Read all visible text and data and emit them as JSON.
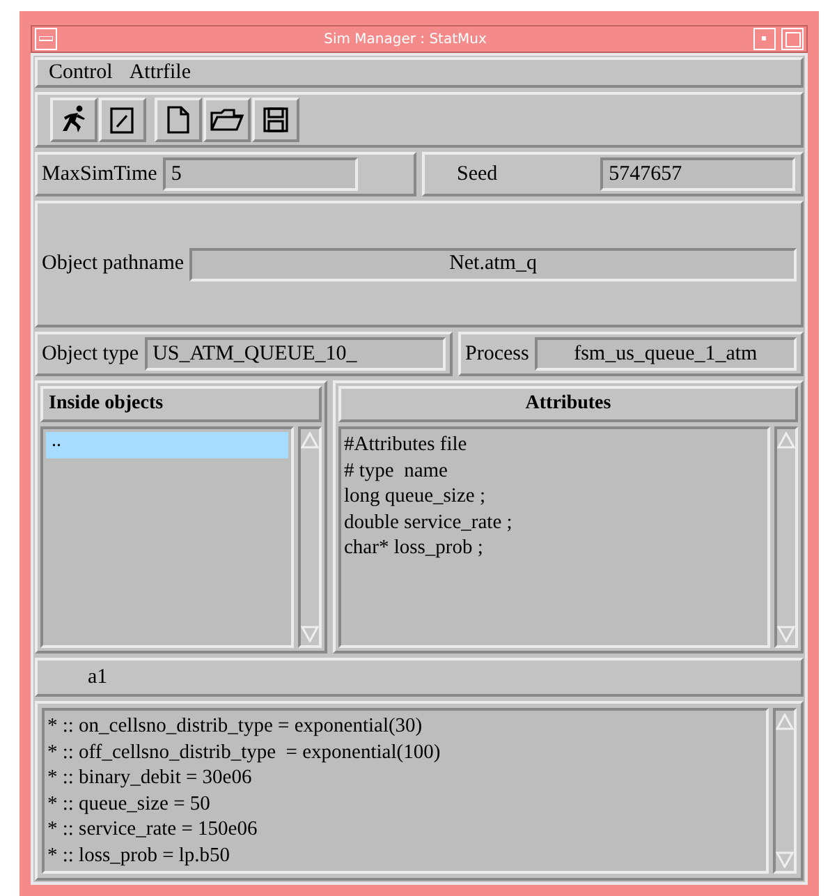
{
  "window": {
    "title": "Sim Manager : StatMux"
  },
  "menu": [
    "Control",
    "Attrfile"
  ],
  "toolbar": [
    {
      "kind": "run"
    },
    {
      "kind": "edit"
    },
    {
      "kind": "new"
    },
    {
      "kind": "open"
    },
    {
      "kind": "save"
    }
  ],
  "max_sim_time": {
    "label": "MaxSimTime",
    "value": "5"
  },
  "seed": {
    "label": "Seed",
    "value": "5747657"
  },
  "object_pathname": {
    "label": "Object pathname",
    "value": "Net.atm_q"
  },
  "object_type": {
    "label": "Object type",
    "value": "US_ATM_QUEUE_10_"
  },
  "process": {
    "label": "Process",
    "value": "fsm_us_queue_1_atm"
  },
  "inside_objects": {
    "title": "Inside objects",
    "items": [
      {
        "label": "..",
        "selected": true
      }
    ]
  },
  "attributes": {
    "title": "Attributes",
    "lines": [
      "#Attributes file",
      "# type  name",
      "long queue_size ;",
      "double service_rate ;",
      "char* loss_prob ;"
    ]
  },
  "object_name": "a1",
  "values": [
    "* :: on_cellsno_distrib_type = exponential(30)",
    "* :: off_cellsno_distrib_type  = exponential(100)",
    "* :: binary_debit = 30e06",
    "* :: queue_size = 50",
    "* :: service_rate = 150e06",
    "* :: loss_prob = lp.b50"
  ]
}
